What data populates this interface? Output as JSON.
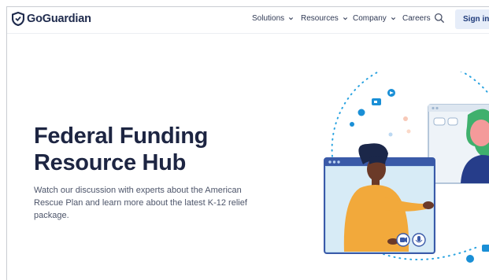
{
  "header": {
    "brand": "GoGuardian",
    "nav": [
      {
        "label": "Solutions",
        "has_dropdown": true
      },
      {
        "label": "Resources",
        "has_dropdown": true
      },
      {
        "label": "Company",
        "has_dropdown": true
      },
      {
        "label": "Careers",
        "has_dropdown": false
      }
    ],
    "search_icon": "search-icon",
    "signin_label": "Sign in"
  },
  "hero": {
    "title_line1": "Federal Funding",
    "title_line2": "Resource Hub",
    "description": "Watch our discussion with experts about the American Rescue Plan and learn more about the latest K-12 relief package."
  },
  "colors": {
    "brand_navy": "#1d2542",
    "accent_blue": "#1a8fd6",
    "signin_bg": "#e6edf9"
  }
}
